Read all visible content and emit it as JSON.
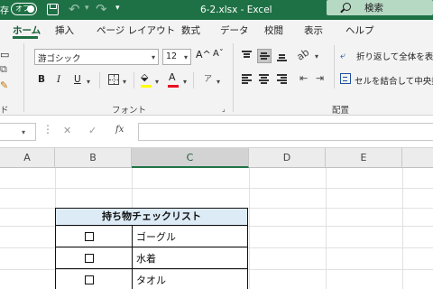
{
  "titlebar": {
    "autosave_label": "存",
    "toggle_label": "オフ",
    "file_name": "6-2.xlsx  -  Excel",
    "search_label": "検索"
  },
  "tabs": [
    {
      "label": "ホーム",
      "active": true
    },
    {
      "label": "挿入"
    },
    {
      "label": "ページ レイアウト"
    },
    {
      "label": "数式"
    },
    {
      "label": "データ"
    },
    {
      "label": "校閲"
    },
    {
      "label": "表示"
    },
    {
      "label": "ヘルプ"
    }
  ],
  "ribbon": {
    "clipboard_label": "ド",
    "font_group": {
      "font_name": "游ゴシック",
      "font_size": "12",
      "grow_font": "A^",
      "shrink_font": "Aˇ",
      "bold": "B",
      "italic": "I",
      "underline": "U",
      "font_color_letter": "A",
      "phonetic": "ア",
      "label": "フォント"
    },
    "align_group": {
      "wrap_text": "折り返して全体を表示",
      "merge_center": "セルを結合して中央揃",
      "label": "配置"
    }
  },
  "formula_bar": {
    "cancel": "✕",
    "enter": "✓",
    "fx": "fx",
    "content": ""
  },
  "columns": [
    "A",
    "B",
    "C",
    "D",
    "E"
  ],
  "selected_column": "C",
  "checklist": {
    "title": "持ち物チェックリスト",
    "items": [
      "ゴーグル",
      "水着",
      "タオル"
    ]
  },
  "colors": {
    "excel_green": "#1e7145",
    "header_fill": "#ddebf7",
    "font_color": "#e81123"
  }
}
